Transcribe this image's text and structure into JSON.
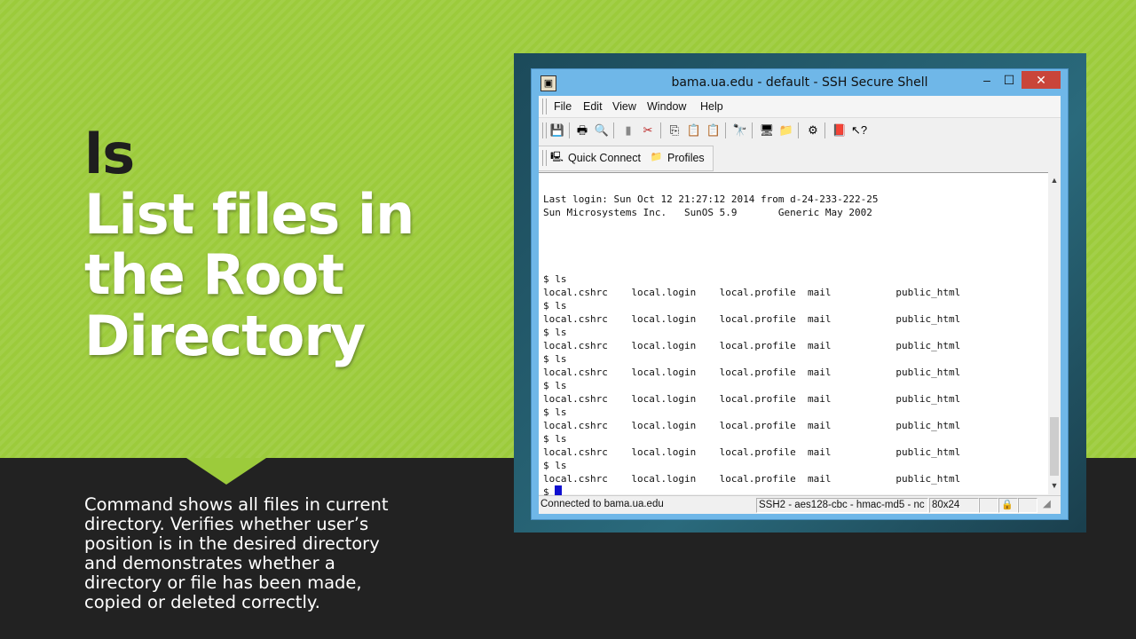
{
  "slide": {
    "title_command": "ls",
    "title_lines": [
      "List files in",
      "the Root",
      "Directory"
    ],
    "description": "Command shows all files in current directory. Verifies whether user’s position is in the desired directory and demonstrates whether a directory or file has been made, copied or deleted correctly.",
    "colors": {
      "accent": "#9ccb3b",
      "dark": "#222222"
    }
  },
  "window": {
    "title": "bama.ua.edu - default - SSH Secure Shell",
    "controls": {
      "minimize": "–",
      "maximize": "☐",
      "close": "✕"
    },
    "menu": [
      "File",
      "Edit",
      "View",
      "Window",
      "Help"
    ],
    "toolbar_icons": [
      "save-icon",
      "print-icon",
      "print-preview-icon",
      "paste-disabled-icon",
      "disconnect-icon",
      "copy-icon",
      "paste-icon",
      "paste-alt-icon",
      "find-icon",
      "new-terminal-icon",
      "file-transfer-icon",
      "settings-icon",
      "help-book-icon",
      "context-help-icon"
    ],
    "quick_connect": "Quick Connect",
    "profiles": "Profiles",
    "terminal_lines": [
      "Last login: Sun Oct 12 21:27:12 2014 from d-24-233-222-25",
      "Sun Microsystems Inc.   SunOS 5.9       Generic May 2002",
      "",
      "",
      "",
      "",
      "$ ls",
      "local.cshrc    local.login    local.profile  mail           public_html",
      "$ ls",
      "local.cshrc    local.login    local.profile  mail           public_html",
      "$ ls",
      "local.cshrc    local.login    local.profile  mail           public_html",
      "$ ls",
      "local.cshrc    local.login    local.profile  mail           public_html",
      "$ ls",
      "local.cshrc    local.login    local.profile  mail           public_html",
      "$ ls",
      "local.cshrc    local.login    local.profile  mail           public_html",
      "$ ls",
      "local.cshrc    local.login    local.profile  mail           public_html",
      "$ ls",
      "local.cshrc    local.login    local.profile  mail           public_html"
    ],
    "prompt": "$ ",
    "status": {
      "connection": "Connected to bama.ua.edu",
      "cipher": "SSH2 - aes128-cbc - hmac-md5 - nc",
      "size": "80x24"
    }
  }
}
